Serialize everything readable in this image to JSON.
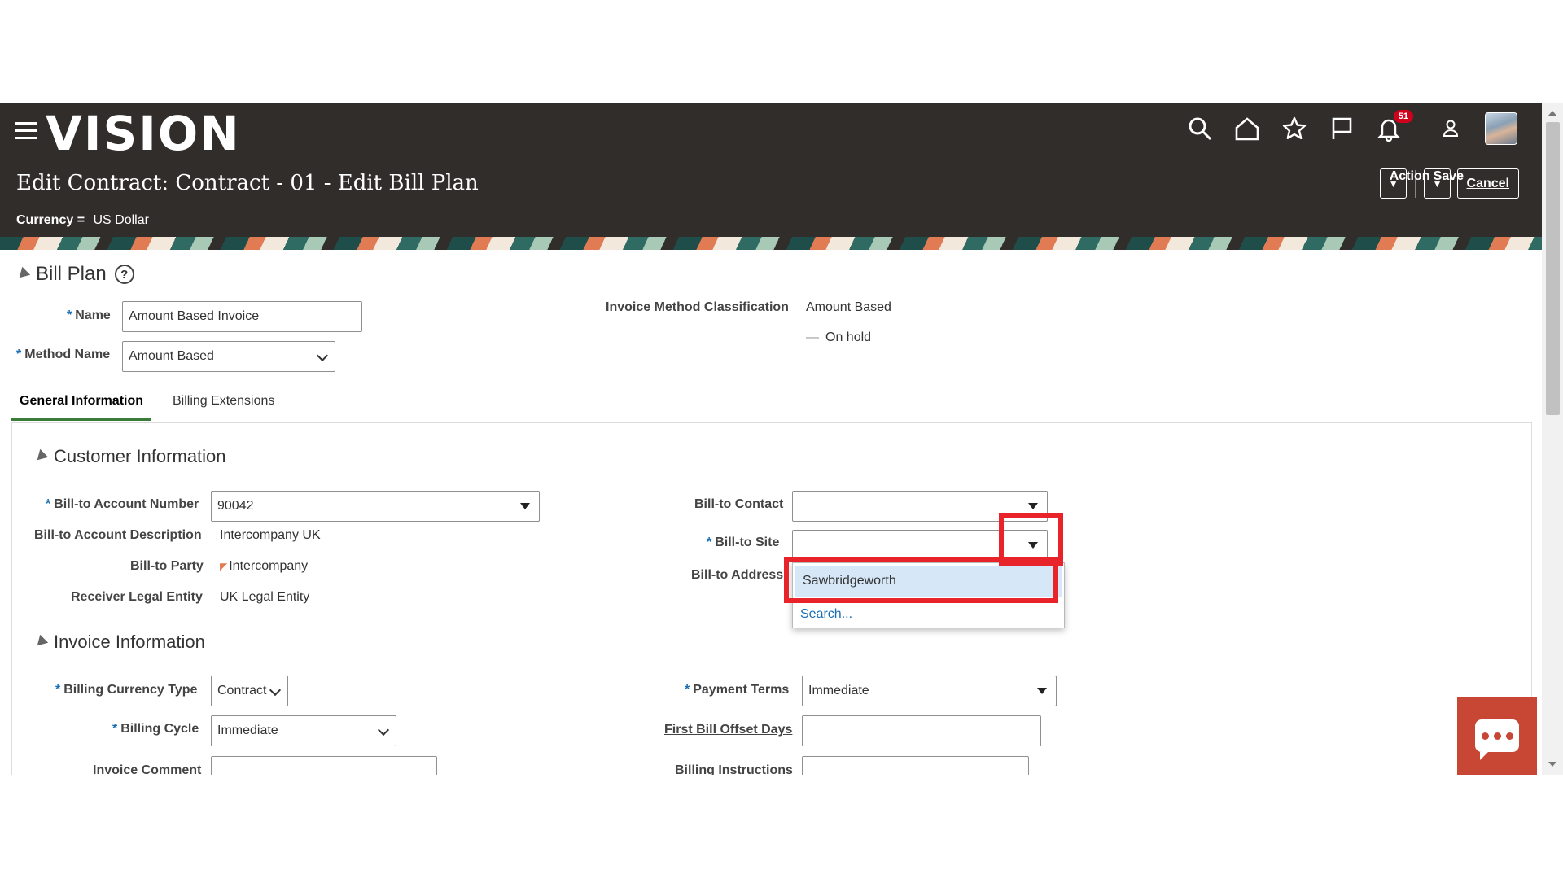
{
  "header": {
    "logo": "VISION",
    "page_title": "Edit Contract: Contract - 01 - Edit Bill Plan",
    "currency_label": "Currency =",
    "currency_value": "US Dollar",
    "notification_count": "51",
    "buttons": {
      "action": "Action",
      "save": "Save",
      "cancel": "Cancel"
    },
    "icons": [
      "hamburger-icon",
      "search-icon",
      "home-icon",
      "star-icon",
      "flag-icon",
      "bell-icon",
      "person-icon"
    ]
  },
  "bill_plan": {
    "title": "Bill Plan",
    "help": "?",
    "name_label": "Name",
    "name_value": "Amount Based Invoice",
    "method_label": "Method Name",
    "method_value": "Amount Based",
    "invoice_method_label": "Invoice Method Classification",
    "invoice_method_value": "Amount Based",
    "on_hold_label": "On hold"
  },
  "tabs": [
    {
      "label": "General Information",
      "active": true
    },
    {
      "label": "Billing Extensions",
      "active": false
    }
  ],
  "customer": {
    "title": "Customer Information",
    "account_number_label": "Bill-to Account Number",
    "account_number_value": "90042",
    "account_desc_label": "Bill-to Account Description",
    "account_desc_value": "Intercompany UK",
    "party_label": "Bill-to Party",
    "party_value": "Intercompany",
    "legal_entity_label": "Receiver Legal Entity",
    "legal_entity_value": "UK Legal Entity",
    "contact_label": "Bill-to Contact",
    "contact_value": "",
    "site_label": "Bill-to Site",
    "site_value": "",
    "address_label": "Bill-to Address"
  },
  "site_dropdown": {
    "options": [
      "Sawbridgeworth"
    ],
    "search_link": "Search..."
  },
  "invoice": {
    "title": "Invoice Information",
    "currency_type_label": "Billing Currency Type",
    "currency_type_value": "Contract",
    "cycle_label": "Billing Cycle",
    "cycle_value": "Immediate",
    "comment_label": "Invoice Comment",
    "payment_terms_label": "Payment Terms",
    "payment_terms_value": "Immediate",
    "offset_label": "First Bill Offset Days",
    "instructions_label": "Billing Instructions"
  },
  "colors": {
    "header_bg": "#312d2a",
    "highlight": "#e8232a",
    "chat_bg": "#c74634",
    "required": "#1a6fb4"
  }
}
